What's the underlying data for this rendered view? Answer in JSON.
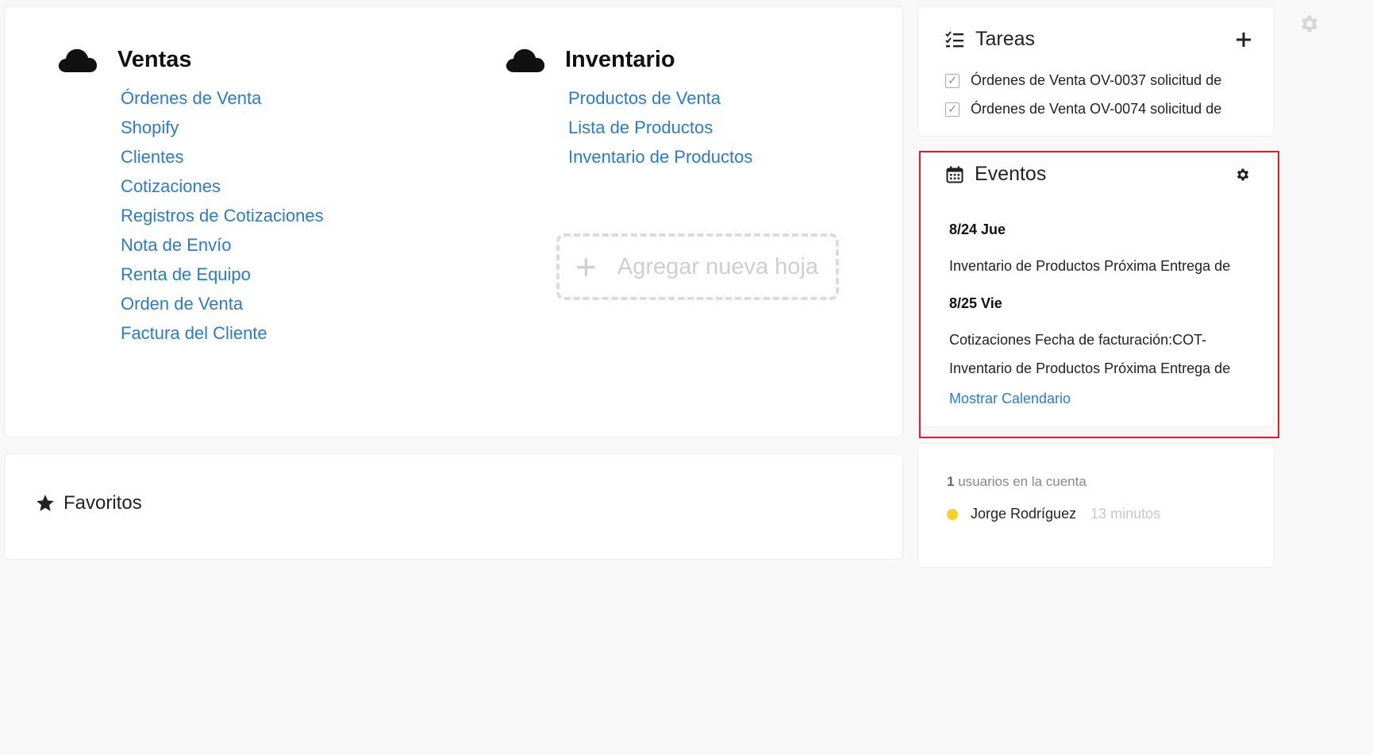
{
  "apps": {
    "ventas": {
      "title": "Ventas",
      "links": [
        "Órdenes de Venta",
        "Shopify",
        "Clientes",
        "Cotizaciones",
        "Registros de Cotizaciones",
        "Nota de Envío",
        "Renta de Equipo",
        "Orden de Venta",
        "Factura del Cliente"
      ]
    },
    "inventario": {
      "title": "Inventario",
      "links": [
        "Productos de Venta",
        "Lista de Productos",
        "Inventario de Productos"
      ]
    },
    "add_sheet_label": "Agregar nueva hoja",
    "icon": "cloud-icon"
  },
  "favorites": {
    "title": "Favoritos",
    "icon": "star-icon"
  },
  "tasks": {
    "title": "Tareas",
    "icon": "task-list-icon",
    "add_icon": "plus-icon",
    "items": [
      "Órdenes de Venta OV-0037 solicitud de",
      "Órdenes de Venta OV-0074 solicitud de"
    ]
  },
  "events": {
    "title": "Eventos",
    "icon": "calendar-icon",
    "settings_icon": "gear-icon",
    "days": [
      {
        "date": "8/24 Jue",
        "items": [
          "Inventario de Productos Próxima Entrega de"
        ]
      },
      {
        "date": "8/25 Vie",
        "items": [
          "Cotizaciones Fecha de facturación:COT-",
          "Inventario de Productos Próxima Entrega de"
        ]
      }
    ],
    "show_calendar": "Mostrar Calendario",
    "highlight_color": "#e02020"
  },
  "users": {
    "count": "1",
    "count_label": "usuarios en la cuenta",
    "list": [
      {
        "name": "Jorge Rodríguez",
        "time": "13 minutos",
        "status_color": "#f3d02a"
      }
    ]
  },
  "colors": {
    "link": "#2a7cc7",
    "background": "#f8f8f8"
  }
}
